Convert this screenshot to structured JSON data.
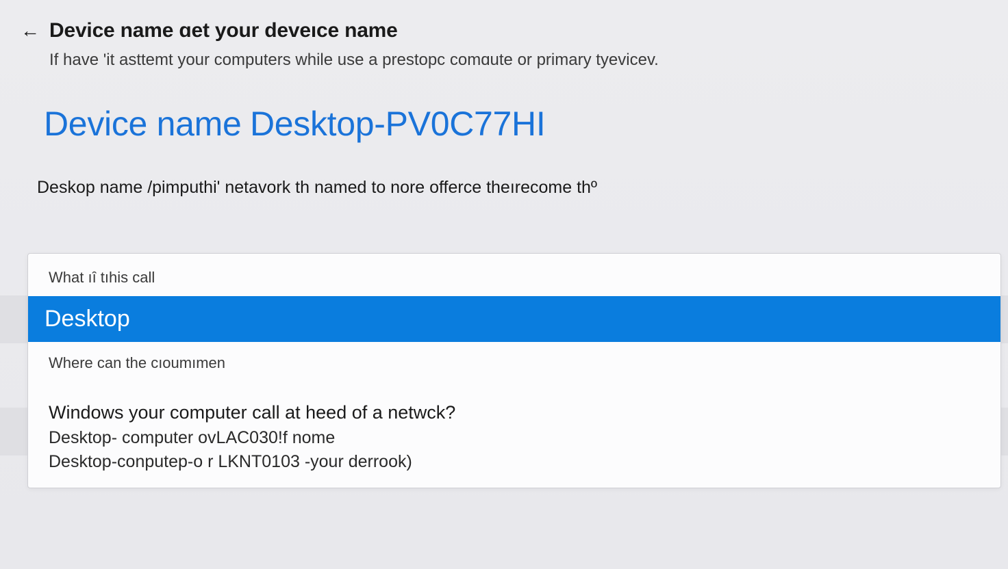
{
  "header": {
    "title": "Device name ɑet your deveıce name",
    "subtitle": "If have 'it asttemt your computers while use a prestopc comɑute or primary tyevicev."
  },
  "device": {
    "label": "Device  name",
    "value": "Desktop-PV0C77HI"
  },
  "description": "Deskop name /pimputhi' netavork th  named to nore offerce theırecome  thº",
  "dialog": {
    "labelTop": "What ıȋ tıhis call",
    "inputValue": "Desktop",
    "labelBottom": "Where can the cıoumımen"
  },
  "info": {
    "heading": "Windows your computer call at heed of a netwck?",
    "line1": "Desktop- computer ovLAC030!f nome",
    "line2": "Desktop-conputep-o r LKNT0103 -your derrook)"
  }
}
